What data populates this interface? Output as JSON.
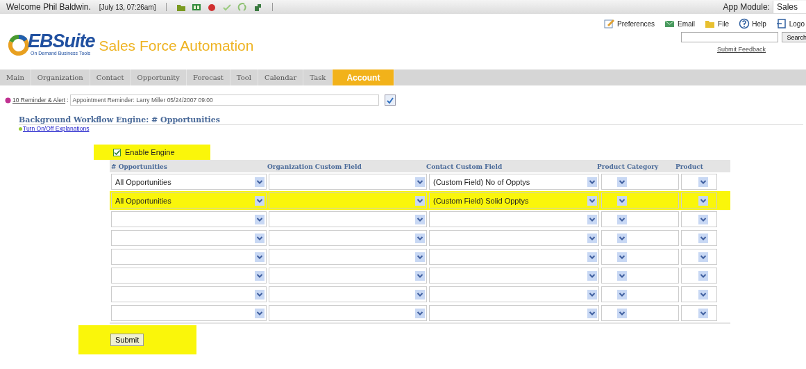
{
  "top_bar": {
    "welcome": "Welcome Phil Baldwin.",
    "datetime": "[July 13, 07:26am]",
    "app_module_label": "App Module:",
    "app_module_value": "Sales"
  },
  "header": {
    "logo_text": "EBSuite",
    "logo_tagline": "On Demand Business Tools",
    "app_title": "Sales Force Automation",
    "links": [
      {
        "kind": "preferences",
        "label": "Preferences"
      },
      {
        "kind": "email",
        "label": "Email"
      },
      {
        "kind": "file",
        "label": "File"
      },
      {
        "kind": "help",
        "label": "Help"
      },
      {
        "kind": "logout",
        "label": "Logo"
      }
    ],
    "search_button": "Search",
    "feedback_link": "Submit Feedback"
  },
  "nav_tabs": [
    {
      "label": "Main",
      "selected": false
    },
    {
      "label": "Organization",
      "selected": false
    },
    {
      "label": "Contact",
      "selected": false
    },
    {
      "label": "Opportunity",
      "selected": false
    },
    {
      "label": "Forecast",
      "selected": false
    },
    {
      "label": "Tool",
      "selected": false
    },
    {
      "label": "Calendar",
      "selected": false
    },
    {
      "label": "Task",
      "selected": false
    },
    {
      "label": "Account",
      "selected": true
    }
  ],
  "reminder": {
    "link": "10 Reminder & Alert",
    "separator": ":",
    "value": "Appointment Reminder: Larry Miller 05/24/2007 09:00"
  },
  "page_title": "Background Workflow Engine: # Opportunities",
  "explanations_link": "Turn On/Off Explanations",
  "enable_engine": {
    "label": "Enable Engine",
    "checked": true,
    "highlighted": true
  },
  "table": {
    "columns": [
      "# Opportunities",
      "Organization Custom Field",
      "Contact Custom Field",
      "Product Category",
      "Product"
    ],
    "rows": [
      {
        "highlighted": false,
        "cells": [
          "All Opportunities",
          "",
          "(Custom Field) No of Opptys",
          "",
          ""
        ]
      },
      {
        "highlighted": true,
        "cells": [
          "All Opportunities",
          "",
          "(Custom Field) Solid Opptys",
          "",
          ""
        ]
      },
      {
        "highlighted": false,
        "cells": [
          "",
          "",
          "",
          "",
          ""
        ]
      },
      {
        "highlighted": false,
        "cells": [
          "",
          "",
          "",
          "",
          ""
        ]
      },
      {
        "highlighted": false,
        "cells": [
          "",
          "",
          "",
          "",
          ""
        ]
      },
      {
        "highlighted": false,
        "cells": [
          "",
          "",
          "",
          "",
          ""
        ]
      },
      {
        "highlighted": false,
        "cells": [
          "",
          "",
          "",
          "",
          ""
        ]
      },
      {
        "highlighted": false,
        "cells": [
          "",
          "",
          "",
          "",
          ""
        ]
      }
    ]
  },
  "submit": {
    "label": "Submit",
    "highlighted": true
  }
}
